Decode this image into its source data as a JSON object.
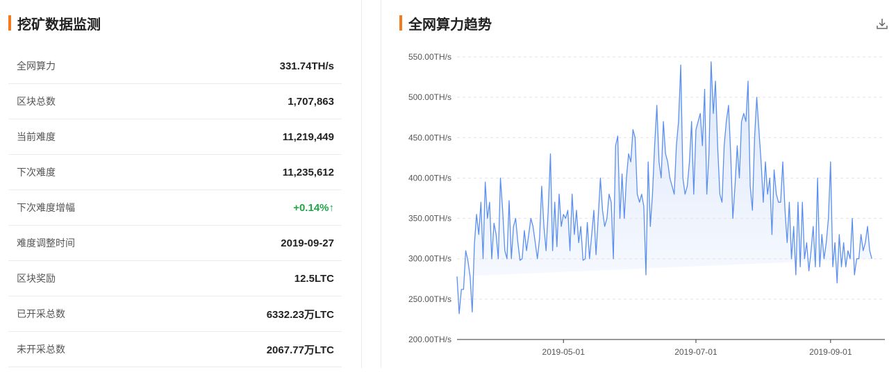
{
  "left": {
    "title": "挖矿数据监测",
    "stats": [
      {
        "label": "全网算力",
        "value": "331.74TH/s"
      },
      {
        "label": "区块总数",
        "value": "1,707,863"
      },
      {
        "label": "当前难度",
        "value": "11,219,449"
      },
      {
        "label": "下次难度",
        "value": "11,235,612"
      },
      {
        "label": "下次难度增幅",
        "value": "+0.14%↑",
        "status": "up"
      },
      {
        "label": "难度调整时间",
        "value": "2019-09-27"
      },
      {
        "label": "区块奖励",
        "value": "12.5LTC"
      },
      {
        "label": "已开采总数",
        "value": "6332.23万LTC"
      },
      {
        "label": "未开采总数",
        "value": "2067.77万LTC"
      }
    ]
  },
  "right": {
    "title": "全网算力趋势",
    "download_icon": "download-icon"
  },
  "colors": {
    "accent": "#f37b1d",
    "up": "#22a447",
    "line": "#5b8ff0",
    "area": "#dce7fb"
  },
  "chart_data": {
    "type": "area",
    "title": "全网算力趋势",
    "xlabel": "",
    "ylabel": "",
    "unit": "TH/s",
    "ylim": [
      200,
      550
    ],
    "y_ticks": [
      "200.00TH/s",
      "250.00TH/s",
      "300.00TH/s",
      "350.00TH/s",
      "400.00TH/s",
      "450.00TH/s",
      "500.00TH/s",
      "550.00TH/s"
    ],
    "y_tick_values": [
      200,
      250,
      300,
      350,
      400,
      450,
      500,
      550
    ],
    "xlim": [
      "2019-03-13",
      "2019-09-26"
    ],
    "x_ticks": [
      "2019-05-01",
      "2019-07-01",
      "2019-09-01"
    ],
    "grid": true,
    "x": [
      "2019-03-13",
      "2019-03-14",
      "2019-03-15",
      "2019-03-16",
      "2019-03-17",
      "2019-03-18",
      "2019-03-19",
      "2019-03-20",
      "2019-03-21",
      "2019-03-22",
      "2019-03-23",
      "2019-03-24",
      "2019-03-25",
      "2019-03-26",
      "2019-03-27",
      "2019-03-28",
      "2019-03-29",
      "2019-03-30",
      "2019-03-31",
      "2019-04-01",
      "2019-04-02",
      "2019-04-03",
      "2019-04-04",
      "2019-04-05",
      "2019-04-06",
      "2019-04-07",
      "2019-04-08",
      "2019-04-09",
      "2019-04-10",
      "2019-04-11",
      "2019-04-12",
      "2019-04-13",
      "2019-04-14",
      "2019-04-15",
      "2019-04-16",
      "2019-04-17",
      "2019-04-18",
      "2019-04-19",
      "2019-04-20",
      "2019-04-21",
      "2019-04-22",
      "2019-04-23",
      "2019-04-24",
      "2019-04-25",
      "2019-04-26",
      "2019-04-27",
      "2019-04-28",
      "2019-04-29",
      "2019-04-30",
      "2019-05-01",
      "2019-05-02",
      "2019-05-03",
      "2019-05-04",
      "2019-05-05",
      "2019-05-06",
      "2019-05-07",
      "2019-05-08",
      "2019-05-09",
      "2019-05-10",
      "2019-05-11",
      "2019-05-12",
      "2019-05-13",
      "2019-05-14",
      "2019-05-15",
      "2019-05-16",
      "2019-05-17",
      "2019-05-18",
      "2019-05-19",
      "2019-05-20",
      "2019-05-21",
      "2019-05-22",
      "2019-05-23",
      "2019-05-24",
      "2019-05-25",
      "2019-05-26",
      "2019-05-27",
      "2019-05-28",
      "2019-05-29",
      "2019-05-30",
      "2019-05-31",
      "2019-06-01",
      "2019-06-02",
      "2019-06-03",
      "2019-06-04",
      "2019-06-05",
      "2019-06-06",
      "2019-06-07",
      "2019-06-08",
      "2019-06-09",
      "2019-06-10",
      "2019-06-11",
      "2019-06-12",
      "2019-06-13",
      "2019-06-14",
      "2019-06-15",
      "2019-06-16",
      "2019-06-17",
      "2019-06-18",
      "2019-06-19",
      "2019-06-20",
      "2019-06-21",
      "2019-06-22",
      "2019-06-23",
      "2019-06-24",
      "2019-06-25",
      "2019-06-26",
      "2019-06-27",
      "2019-06-28",
      "2019-06-29",
      "2019-06-30",
      "2019-07-01",
      "2019-07-02",
      "2019-07-03",
      "2019-07-04",
      "2019-07-05",
      "2019-07-06",
      "2019-07-07",
      "2019-07-08",
      "2019-07-09",
      "2019-07-10",
      "2019-07-11",
      "2019-07-12",
      "2019-07-13",
      "2019-07-14",
      "2019-07-15",
      "2019-07-16",
      "2019-07-17",
      "2019-07-18",
      "2019-07-19",
      "2019-07-20",
      "2019-07-21",
      "2019-07-22",
      "2019-07-23",
      "2019-07-24",
      "2019-07-25",
      "2019-07-26",
      "2019-07-27",
      "2019-07-28",
      "2019-07-29",
      "2019-07-30",
      "2019-07-31",
      "2019-08-01",
      "2019-08-02",
      "2019-08-03",
      "2019-08-04",
      "2019-08-05",
      "2019-08-06",
      "2019-08-07",
      "2019-08-08",
      "2019-08-09",
      "2019-08-10",
      "2019-08-11",
      "2019-08-12",
      "2019-08-13",
      "2019-08-14",
      "2019-08-15",
      "2019-08-16",
      "2019-08-17",
      "2019-08-18",
      "2019-08-19",
      "2019-08-20",
      "2019-08-21",
      "2019-08-22",
      "2019-08-23",
      "2019-08-24",
      "2019-08-25",
      "2019-08-26",
      "2019-08-27",
      "2019-08-28",
      "2019-08-29",
      "2019-08-30",
      "2019-08-31",
      "2019-09-01",
      "2019-09-02",
      "2019-09-03",
      "2019-09-04",
      "2019-09-05",
      "2019-09-06",
      "2019-09-07",
      "2019-09-08",
      "2019-09-09",
      "2019-09-10",
      "2019-09-11",
      "2019-09-12",
      "2019-09-13",
      "2019-09-14",
      "2019-09-15",
      "2019-09-16",
      "2019-09-17",
      "2019-09-18",
      "2019-09-19",
      "2019-09-20",
      "2019-09-21",
      "2019-09-22",
      "2019-09-23",
      "2019-09-24",
      "2019-09-25",
      "2019-09-26"
    ],
    "series": [
      {
        "values": [
          278,
          232,
          262,
          262,
          310,
          298,
          278,
          234,
          318,
          355,
          330,
          370,
          300,
          395,
          350,
          370,
          300,
          344,
          330,
          300,
          400,
          360,
          310,
          300,
          372,
          300,
          340,
          350,
          320,
          298,
          300,
          335,
          310,
          330,
          350,
          340,
          320,
          300,
          325,
          390,
          340,
          310,
          360,
          430,
          310,
          370,
          315,
          380,
          340,
          355,
          350,
          360,
          310,
          380,
          330,
          360,
          320,
          340,
          298,
          300,
          345,
          300,
          330,
          360,
          305,
          350,
          400,
          360,
          340,
          350,
          380,
          370,
          300,
          440,
          452,
          350,
          405,
          350,
          400,
          430,
          420,
          460,
          450,
          380,
          370,
          380,
          365,
          280,
          420,
          340,
          380,
          440,
          490,
          420,
          400,
          470,
          430,
          420,
          400,
          390,
          380,
          440,
          470,
          540,
          400,
          380,
          390,
          420,
          470,
          380,
          460,
          470,
          480,
          440,
          510,
          380,
          430,
          544,
          480,
          520,
          440,
          380,
          370,
          440,
          470,
          490,
          430,
          350,
          390,
          440,
          400,
          470,
          480,
          470,
          520,
          390,
          360,
          450,
          500,
          460,
          420,
          370,
          420,
          380,
          400,
          330,
          410,
          380,
          370,
          370,
          420,
          360,
          320,
          370,
          300,
          340,
          280,
          370,
          290,
          370,
          300,
          320,
          285,
          310,
          340,
          290,
          400,
          290,
          330,
          300,
          320,
          350,
          420,
          290,
          320,
          270,
          330,
          290,
          320,
          290,
          310,
          300,
          350,
          280,
          300,
          300,
          330,
          310,
          320,
          340,
          310,
          300
        ]
      }
    ]
  }
}
